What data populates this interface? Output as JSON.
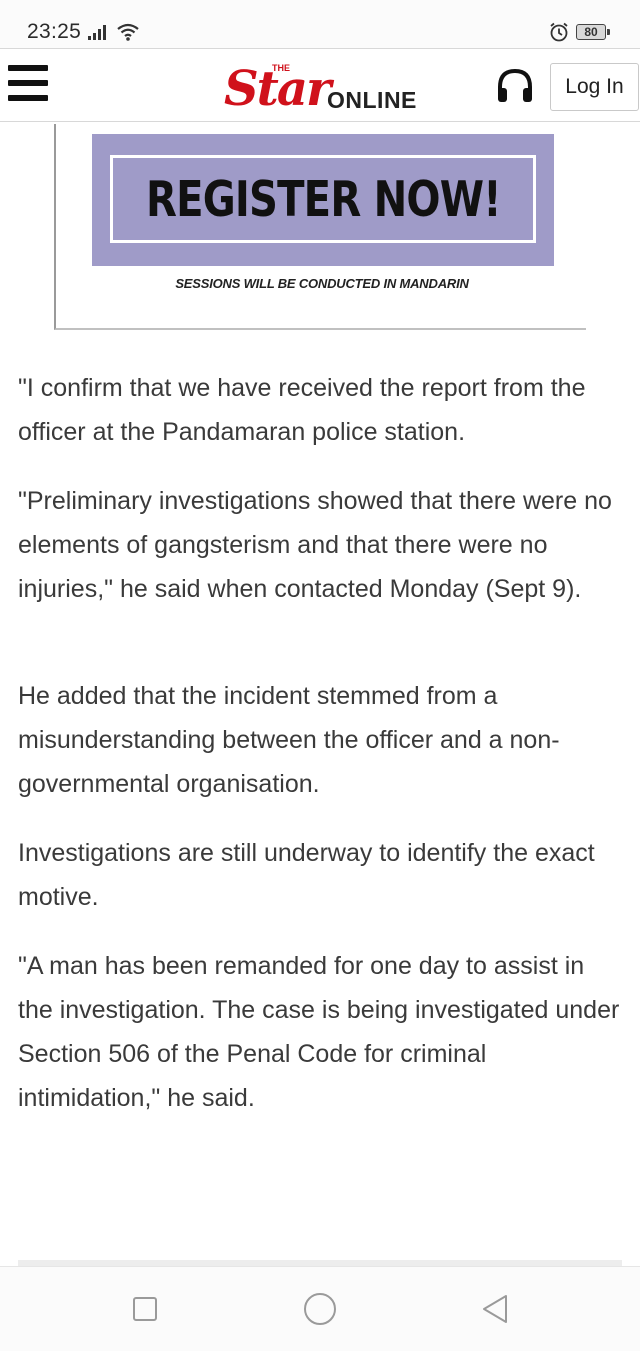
{
  "status_bar": {
    "time": "23:25",
    "battery": "80",
    "icons": [
      "signal-icon",
      "wifi-icon",
      "alarm-icon",
      "battery-icon"
    ]
  },
  "header": {
    "logo_the": "THE",
    "logo_star": "Star",
    "logo_online": "ONLINE",
    "login_label": "Log In",
    "icons": [
      "menu-icon",
      "headphones-icon"
    ],
    "brand_color": "#d0111b"
  },
  "ad": {
    "headline": "REGISTER NOW!",
    "subtext": "SESSIONS WILL BE CONDUCTED IN MANDARIN",
    "banner_color": "#9f9bc8"
  },
  "article": {
    "paragraphs": [
      "\"I confirm that we have received the report from the officer at the Pandamaran police station.",
      "\"Preliminary investigations showed that there were no elements of gangsterism and that there were no injuries,\" he said when contacted Monday (Sept 9).",
      "He added that the incident stemmed from a misunderstanding between the officer and a non-governmental organisation.",
      "Investigations are still underway to identify the exact motive.",
      "\"A man has been remanded for one day to assist in the investigation. The case is being investigated under Section 506 of the Penal Code for criminal intimidation,\" he said."
    ]
  },
  "nav_bar": {
    "icons": [
      "recent-apps-icon",
      "home-icon",
      "back-icon"
    ]
  }
}
